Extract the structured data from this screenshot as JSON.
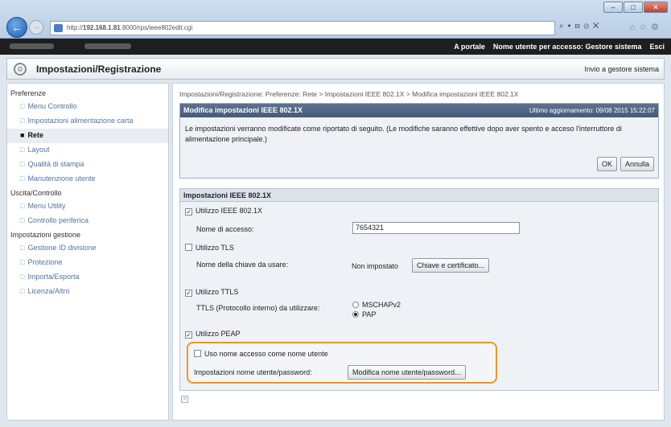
{
  "browser": {
    "url_prefix": "http://",
    "url_host": "192.168.1.81",
    "url_path": ":8000/rps/ieee802edit.cgi",
    "addr_tools": "⌕ ▾ ⊟ ⊘ ✕",
    "window_buttons": [
      "–",
      "□",
      "✕"
    ]
  },
  "topbar": {
    "portal_link": "A portale",
    "user_label": "Nome utente per accesso: Gestore sistema",
    "logout": "Esci"
  },
  "header": {
    "title": "Impostazioni/Registrazione",
    "home_link": "Invio a gestore sistema"
  },
  "sidebar": {
    "sections": [
      {
        "title": "Preferenze",
        "items": [
          "Menu Controllo",
          "Impostazioni alimentazione carta",
          "Rete",
          "Layout",
          "Qualità di stampa",
          "Manutenzione utente"
        ]
      },
      {
        "title": "Uscita/Controllo",
        "items": [
          "Menu Utility",
          "Controllo periferica"
        ]
      },
      {
        "title": "Impostazioni gestione",
        "items": [
          "Gestione ID divisione",
          "Protezione",
          "Importa/Esporta",
          "Licenza/Altro"
        ]
      }
    ],
    "active_item": "Rete"
  },
  "main": {
    "breadcrumb": "Impostazioni/Registrazione: Preferenze: Rete > Impostazioni IEEE 802.1X > Modifica impostazioni IEEE 802.1X",
    "panel_title": "Modifica impostazioni IEEE 802.1X",
    "last_updated": "Ultimo aggiornamento: 09/08 2015 15:22:07",
    "message": "Le impostazioni verranno modificate come riportato di seguito. (Le modifiche saranno effettive dopo aver spento e acceso l'interruttore di alimentazione principale.)",
    "ok_label": "OK",
    "cancel_label": "Annulla",
    "settings_title": "Impostazioni IEEE 802.1X",
    "use_ieee": {
      "label": "Utilizzo IEEE 802.1X",
      "checked": true
    },
    "login_name": {
      "label": "Nome di accesso:",
      "value": "7654321"
    },
    "use_tls": {
      "label": "Utilizzo TLS",
      "checked": false
    },
    "key_name": {
      "label": "Nome della chiave da usare:",
      "value": "Non impostato",
      "button": "Chiave e certificato..."
    },
    "use_ttls": {
      "label": "Utilizzo TTLS",
      "checked": true
    },
    "ttls_protocol": {
      "label": "TTLS (Protocollo interno) da utilizzare:",
      "options": [
        "MSCHAPv2",
        "PAP"
      ],
      "selected": "PAP"
    },
    "use_peap": {
      "label": "Utilizzo PEAP",
      "checked": true
    },
    "use_login_as_user": {
      "label": "Uso nome accesso come nome utente",
      "checked": false
    },
    "user_password": {
      "label": "Impostazioni nome utente/password:",
      "button": "Modifica nome utente/password..."
    },
    "checkmark": "✓"
  },
  "colors": {
    "highlight": "#e8962d",
    "panel_header": "#4f6584",
    "link": "#5473a0"
  }
}
